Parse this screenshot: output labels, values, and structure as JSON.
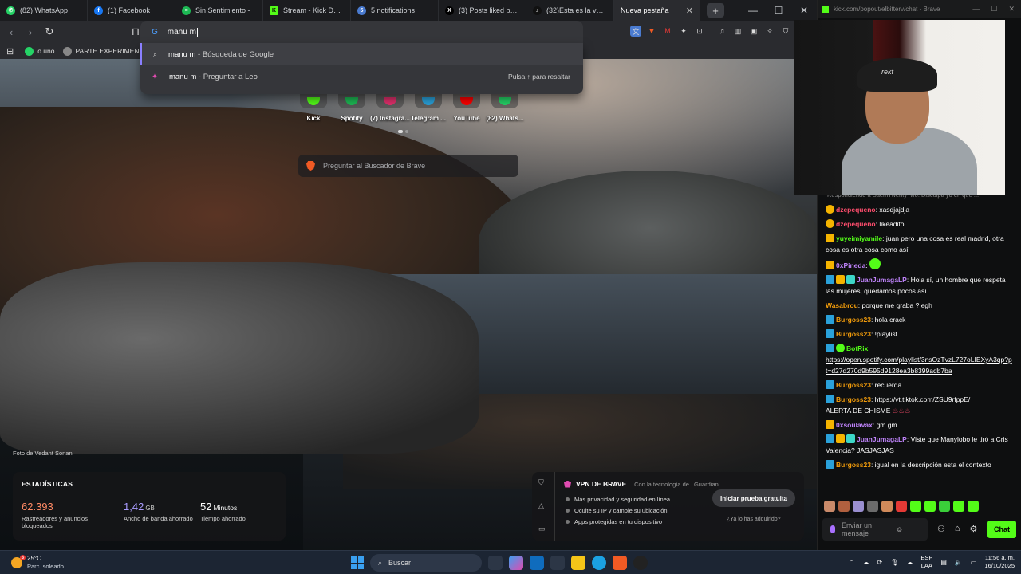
{
  "browser": {
    "tabs": [
      {
        "label": "(82) WhatsApp",
        "icon": "whatsapp-icon",
        "color": "#25d366"
      },
      {
        "label": "(1) Facebook",
        "icon": "facebook-icon",
        "color": "#1877f2"
      },
      {
        "label": "Sin Sentimiento -",
        "icon": "spotify-icon",
        "color": "#1db954"
      },
      {
        "label": "Stream - Kick Dashbo",
        "icon": "kick-icon",
        "color": "#53fc18"
      },
      {
        "label": "5 notifications",
        "icon": "notification-icon",
        "color": "#4a7bd0"
      },
      {
        "label": "(3) Posts liked by ElBi",
        "icon": "x-icon",
        "color": "#000000"
      },
      {
        "label": "(32)Esta es la verdad",
        "icon": "tiktok-icon",
        "color": "#111111"
      }
    ],
    "active_tab": "Nueva pestaña",
    "new_tab_symbol": "+",
    "omnibox": {
      "engine_icon": "G",
      "value": "manu m"
    },
    "bookmarks": [
      {
        "label": "o uno",
        "color": "#25d366"
      },
      {
        "label": "PARTE EXPERIMENT...",
        "color": "#888888"
      }
    ],
    "suggestions": [
      {
        "bold": "manu m",
        "rest": " - Búsqueda de Google",
        "hint": ""
      },
      {
        "bold": "manu m",
        "rest": " - Preguntar a Leo",
        "hint": "Pulsa ↑ para resaltar"
      }
    ]
  },
  "newtab": {
    "tiles": [
      {
        "label": "Kick",
        "color": "#53fc18"
      },
      {
        "label": "Spotify",
        "color": "#1db954"
      },
      {
        "label": "(7) Instagra...",
        "color": "#e1306c"
      },
      {
        "label": "Telegram ...",
        "color": "#2aa1da"
      },
      {
        "label": "YouTube",
        "color": "#ff0000"
      },
      {
        "label": "(82) Whats...",
        "color": "#25d366"
      }
    ],
    "search_placeholder": "Preguntar al Buscador de Brave",
    "photo_credit": "Foto de Vedant Sonani",
    "stats": {
      "title": "ESTADÍSTICAS",
      "items": [
        {
          "value": "62.393",
          "unit": "",
          "label": "Rastreadores y anuncios bloqueados",
          "color": "#ff8a65"
        },
        {
          "value": "1,42",
          "unit": "GB",
          "label": "Ancho de banda ahorrado",
          "color": "#a99bff"
        },
        {
          "value": "52",
          "unit": "Minutos",
          "label": "Tiempo ahorrado",
          "color": "#ffffff"
        }
      ]
    },
    "vpn": {
      "title": "VPN DE BRAVE",
      "powered": "Con la tecnología de",
      "guardian": "Guardian",
      "features": [
        "Más privacidad y seguridad en línea",
        "Oculte su IP y cambie su ubicación",
        "Apps protegidas en tu dispositivo"
      ],
      "cta": "Iniciar prueba gratuita",
      "have": "¿Ya lo has adquirido?"
    }
  },
  "kick": {
    "window_title": "kick.com/popout/elbitterv/chat - Brave",
    "reply_preview": "Respondiendo a SaemTwentyTwo: Discúlpa yo en que ...",
    "messages": [
      {
        "user": "dzepequeno",
        "color": "#ff4d6d",
        "text": "xasdjajdja",
        "link": ""
      },
      {
        "user": "dzepequeno",
        "color": "#ff4d6d",
        "text": "likeadito",
        "link": ""
      },
      {
        "user": "yuyeimiyamile",
        "color": "#53fc18",
        "text": "juan pero una cosa es real madrid, otra cosa es otra cosa como así",
        "link": ""
      },
      {
        "user": "0xPineda",
        "color": "#c084fc",
        "text": "",
        "link": ""
      },
      {
        "user": "JuanJumagaLP",
        "color": "#c084fc",
        "text": "Hola sí, un hombre que respeta las mujeres, quedamos pocos así",
        "link": ""
      },
      {
        "user": "Wasabrou",
        "color": "#f59e0b",
        "text": "porque me graba ? egh",
        "link": ""
      },
      {
        "user": "Burgoss23",
        "color": "#f59e0b",
        "text": "hola crack",
        "link": ""
      },
      {
        "user": "Burgoss23",
        "color": "#f59e0b",
        "text": "!playlist",
        "link": ""
      },
      {
        "user": "BotRix",
        "color": "#53fc18",
        "text": "",
        "link": "https://open.spotify.com/playlist/3nsOzTvzL727oLIEXyA3qp?pt=d27d270d9b595d9128ea3b8399adb7ba"
      },
      {
        "user": "Burgoss23",
        "color": "#f59e0b",
        "text": "recuerda",
        "link": ""
      },
      {
        "user": "Burgoss23",
        "color": "#f59e0b",
        "text": "ALERTA DE CHISME",
        "link": "https://vt.tiktok.com/ZSU9rfppE/"
      },
      {
        "user": "0xsoulavax",
        "color": "#c084fc",
        "text": "gm gm",
        "link": ""
      },
      {
        "user": "JuanJumagaLP",
        "color": "#c084fc",
        "text": "Viste que Manylobo le tiró a Cris Valencia? JASJASJAS",
        "link": ""
      },
      {
        "user": "Burgoss23",
        "color": "#f59e0b",
        "text": "igual en la descripción esta el contexto",
        "link": ""
      }
    ],
    "input_placeholder": "Enviar un mensaje",
    "chat_button": "Chat",
    "webcam_cap_text": "rekt"
  },
  "taskbar": {
    "weather": {
      "temp": "25°C",
      "desc": "Parc. soleado",
      "badge": "3"
    },
    "search_label": "Buscar",
    "lang": {
      "line1": "ESP",
      "line2": "LAA"
    },
    "clock": {
      "time": "11:56 a. m.",
      "date": "16/10/2025"
    }
  }
}
